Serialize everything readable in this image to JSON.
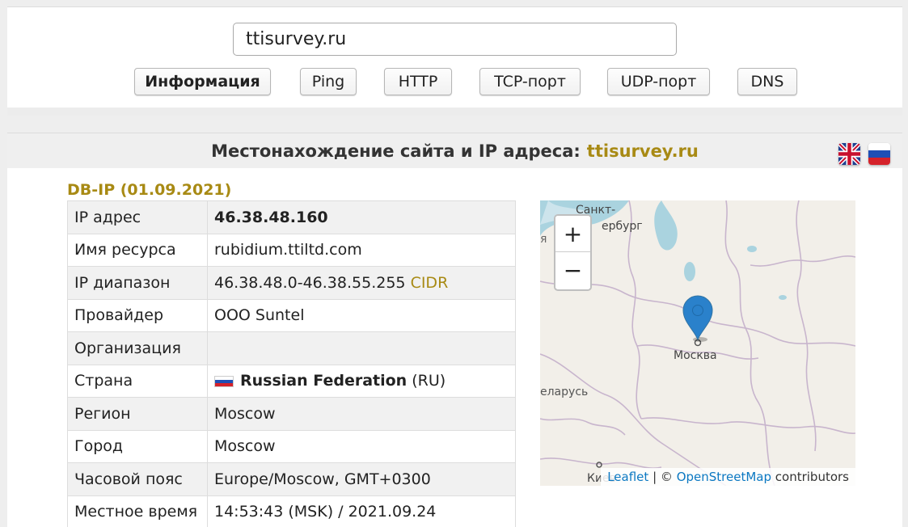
{
  "search": {
    "value": "ttisurvey.ru"
  },
  "tabs": [
    {
      "label": "Информация"
    },
    {
      "label": "Ping"
    },
    {
      "label": "HTTP"
    },
    {
      "label": "TCP-порт"
    },
    {
      "label": "UDP-порт"
    },
    {
      "label": "DNS"
    }
  ],
  "header": {
    "title": "Местонахождение сайта и IP адреса:",
    "domain": "ttisurvey.ru"
  },
  "db_title": "DB-IP (01.09.2021)",
  "rows": [
    {
      "label": "IP адрес",
      "value": "46.38.48.160"
    },
    {
      "label": "Имя ресурса",
      "value": "rubidium.ttiltd.com"
    },
    {
      "label": "IP диапазон",
      "value": "46.38.48.0-46.38.55.255",
      "link": "CIDR"
    },
    {
      "label": "Провайдер",
      "value": "OOO Suntel"
    },
    {
      "label": "Организация",
      "value": ""
    },
    {
      "label": "Страна",
      "value": "Russian Federation",
      "suffix": "(RU)"
    },
    {
      "label": "Регион",
      "value": "Moscow"
    },
    {
      "label": "Город",
      "value": "Moscow"
    },
    {
      "label": "Часовой пояс",
      "value": "Europe/Moscow, GMT+0300"
    },
    {
      "label": "Местное время",
      "value": "14:53:43 (MSK) / 2021.09.24"
    }
  ],
  "map": {
    "zoom_in": "+",
    "zoom_out": "−",
    "labels": {
      "spb1": "Санкт-",
      "spb2": "ербург",
      "moscow": "Москва",
      "belarus": "еларусь",
      "kyiv": "Киев",
      "edge": "я"
    },
    "attribution": {
      "leaflet": "Leaflet",
      "sep": "| ©",
      "osm": "OpenStreetMap",
      "contributors": "contributors"
    },
    "marker_color": "#2a81cb"
  },
  "colors": {
    "accent": "#a88a14",
    "link": "#0b78c2"
  }
}
